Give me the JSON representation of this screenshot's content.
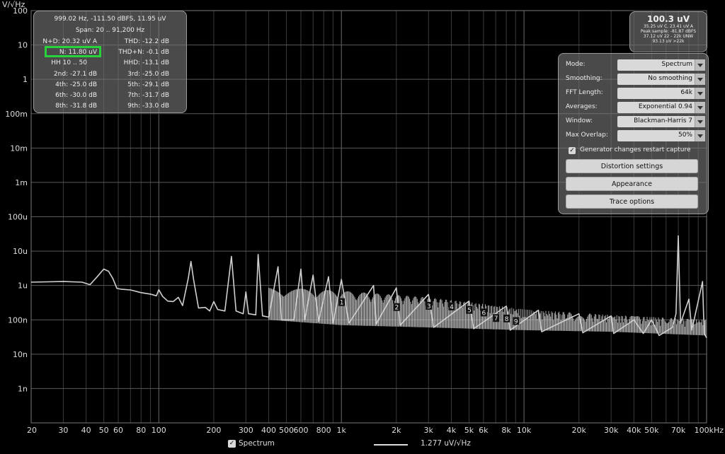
{
  "chart_data": {
    "type": "line",
    "ylabel": "V/√Hz",
    "x_scale": "log",
    "y_scale": "log",
    "xlim": [
      20,
      100000
    ],
    "ylim": [
      1e-10,
      100
    ],
    "x_ticks": [
      {
        "v": 20,
        "label": "20"
      },
      {
        "v": 30,
        "label": "30"
      },
      {
        "v": 40,
        "label": "40"
      },
      {
        "v": 50,
        "label": "50"
      },
      {
        "v": 60,
        "label": "60"
      },
      {
        "v": 80,
        "label": "80"
      },
      {
        "v": 100,
        "label": "100"
      },
      {
        "v": 200,
        "label": "200"
      },
      {
        "v": 300,
        "label": "300"
      },
      {
        "v": 400,
        "label": "400"
      },
      {
        "v": 500,
        "label": "500"
      },
      {
        "v": 600,
        "label": "600"
      },
      {
        "v": 800,
        "label": "800"
      },
      {
        "v": 1000,
        "label": "1k"
      },
      {
        "v": 2000,
        "label": "2k"
      },
      {
        "v": 3000,
        "label": "3k"
      },
      {
        "v": 4000,
        "label": "4k"
      },
      {
        "v": 5000,
        "label": "5k"
      },
      {
        "v": 6000,
        "label": "6k"
      },
      {
        "v": 8000,
        "label": "8k"
      },
      {
        "v": 10000,
        "label": "10k"
      },
      {
        "v": 20000,
        "label": "20k"
      },
      {
        "v": 30000,
        "label": "30k"
      },
      {
        "v": 40000,
        "label": "40k"
      },
      {
        "v": 50000,
        "label": "50k"
      },
      {
        "v": 70000,
        "label": "70k"
      },
      {
        "v": 100000,
        "label": "100kHz"
      }
    ],
    "y_ticks": [
      {
        "v": 100,
        "label": "100"
      },
      {
        "v": 10,
        "label": "10"
      },
      {
        "v": 1,
        "label": "1"
      },
      {
        "v": 0.1,
        "label": "100m"
      },
      {
        "v": 0.01,
        "label": "10m"
      },
      {
        "v": 0.001,
        "label": "1m"
      },
      {
        "v": 0.0001,
        "label": "100u"
      },
      {
        "v": 1e-05,
        "label": "10u"
      },
      {
        "v": 1e-06,
        "label": "1u"
      },
      {
        "v": 1e-07,
        "label": "100n"
      },
      {
        "v": 1e-08,
        "label": "10n"
      },
      {
        "v": 1e-09,
        "label": "1n"
      }
    ],
    "grid": true,
    "series": [
      {
        "name": "Spectrum",
        "color": "#d0d0d0",
        "points": [
          [
            20,
            1.25e-06
          ],
          [
            30,
            1.3e-06
          ],
          [
            38,
            1.25e-06
          ],
          [
            42,
            1.05e-06
          ],
          [
            46,
            1.8e-06
          ],
          [
            50,
            3e-06
          ],
          [
            53,
            2.6e-06
          ],
          [
            56,
            1.6e-06
          ],
          [
            59,
            8.2e-07
          ],
          [
            62,
            7.8e-07
          ],
          [
            70,
            7.4e-07
          ],
          [
            80,
            6.2e-07
          ],
          [
            90,
            5.6e-07
          ],
          [
            97,
            5e-07
          ],
          [
            100,
            7.5e-07
          ],
          [
            105,
            4.8e-07
          ],
          [
            112,
            3.5e-07
          ],
          [
            120,
            3.4e-07
          ],
          [
            128,
            4.5e-07
          ],
          [
            135,
            2.6e-07
          ],
          [
            145,
            1.6e-06
          ],
          [
            150,
            5e-06
          ],
          [
            155,
            1.5e-06
          ],
          [
            165,
            2.2e-07
          ],
          [
            180,
            2.3e-07
          ],
          [
            190,
            1.8e-07
          ],
          [
            200,
            3.4e-07
          ],
          [
            210,
            2e-07
          ],
          [
            230,
            1.8e-07
          ],
          [
            250,
            7e-06
          ],
          [
            265,
            1.8e-07
          ],
          [
            290,
            1.5e-07
          ],
          [
            300,
            6.5e-07
          ],
          [
            310,
            1.5e-07
          ],
          [
            340,
            1.4e-07
          ],
          [
            350,
            8e-06
          ],
          [
            370,
            1.3e-07
          ],
          [
            400,
            1.2e-07
          ],
          [
            450,
            3.5e-06
          ],
          [
            470,
            1e-07
          ],
          [
            550,
            1e-07
          ],
          [
            600,
            3e-06
          ],
          [
            630,
            1e-07
          ],
          [
            700,
            2e-06
          ],
          [
            750,
            9e-08
          ],
          [
            850,
            1.8e-06
          ],
          [
            900,
            8e-08
          ],
          [
            1000,
            1.5e-06
          ],
          [
            1100,
            8e-08
          ],
          [
            1500,
            1e-06
          ],
          [
            1550,
            7.5e-08
          ],
          [
            2000,
            8.5e-07
          ],
          [
            2100,
            7e-08
          ],
          [
            3000,
            5.5e-07
          ],
          [
            3200,
            6e-08
          ],
          [
            5000,
            3.5e-07
          ],
          [
            5300,
            5.5e-08
          ],
          [
            8000,
            2.5e-07
          ],
          [
            8400,
            5e-08
          ],
          [
            12000,
            1.9e-07
          ],
          [
            12500,
            4.5e-08
          ],
          [
            20000,
            1.5e-07
          ],
          [
            21000,
            4.2e-08
          ],
          [
            30000,
            1.3e-07
          ],
          [
            31000,
            4e-08
          ],
          [
            40000,
            1e-07
          ],
          [
            45000,
            4e-08
          ],
          [
            50000,
            1e-07
          ],
          [
            55000,
            3.5e-08
          ],
          [
            65000,
            6e-08
          ],
          [
            68000,
            1.5e-07
          ],
          [
            70000,
            2.8e-05
          ],
          [
            72000,
            8e-08
          ],
          [
            80000,
            4e-07
          ],
          [
            83000,
            5e-08
          ],
          [
            95000,
            1.3e-06
          ],
          [
            97000,
            4e-08
          ],
          [
            100000,
            3e-08
          ]
        ]
      }
    ],
    "floor": [
      [
        400,
        1e-07
      ],
      [
        1000,
        7e-08
      ],
      [
        3000,
        6e-08
      ],
      [
        10000,
        5e-08
      ],
      [
        30000,
        4.5e-08
      ],
      [
        100000,
        3.5e-08
      ]
    ],
    "envelope": [
      [
        400,
        9e-07
      ],
      [
        1000,
        7e-07
      ],
      [
        3000,
        4.5e-07
      ],
      [
        6000,
        2.9e-07
      ],
      [
        10000,
        2e-07
      ],
      [
        30000,
        1.4e-07
      ],
      [
        100000,
        1e-07
      ]
    ],
    "harmonic_markers": [
      {
        "label": "1",
        "f": 999.02,
        "v": 3.2e-07
      },
      {
        "label": "2",
        "f": 2000,
        "v": 2.3e-07
      },
      {
        "label": "3",
        "f": 3000,
        "v": 2.5e-07
      },
      {
        "label": "4",
        "f": 4000,
        "v": 2.4e-07
      },
      {
        "label": "5",
        "f": 5000,
        "v": 1.9e-07
      },
      {
        "label": "6",
        "f": 6000,
        "v": 1.6e-07
      },
      {
        "label": "7",
        "f": 7000,
        "v": 1.1e-07
      },
      {
        "label": "8",
        "f": 8000,
        "v": 1.07e-07
      },
      {
        "label": "9",
        "f": 9000,
        "v": 9e-08
      }
    ]
  },
  "info": {
    "line1": "999.02 Hz, -111.50 dBFS, 11.95 uV",
    "span_label": "Span:",
    "span_value": "20 .. 91,200 Hz",
    "rows": [
      {
        "l_label": "N+D:",
        "l_value": "20.32 uV A",
        "r_label": "THD:",
        "r_value": "-12.2 dB"
      },
      {
        "l_label": "N:",
        "l_value": "11.80 uV",
        "r_label": "THD+N:",
        "r_value": "-0.1 dB"
      },
      {
        "l_label": "HH 10 .. 50",
        "l_value": "",
        "r_label": "HHD:",
        "r_value": "-13.1 dB"
      },
      {
        "l_label": "2nd:",
        "l_value": "-27.1 dB",
        "r_label": "3rd:",
        "r_value": "-25.0 dB"
      },
      {
        "l_label": "4th:",
        "l_value": "-25.0 dB",
        "r_label": "5th:",
        "r_value": "-29.1 dB"
      },
      {
        "l_label": "6th:",
        "l_value": "-30.0 dB",
        "r_label": "7th:",
        "r_value": "-31.7 dB"
      },
      {
        "l_label": "8th:",
        "l_value": "-31.8 dB",
        "r_label": "9th:",
        "r_value": "-33.0 dB"
      }
    ]
  },
  "rms": {
    "main": "100.3 uV",
    "lines": [
      "35.25 uV C, 23.41 uV A",
      "Peak sample: -81.87 dBFS",
      "37.12 uV 22 - 22k UNW",
      "93.13 uV >22k"
    ]
  },
  "settings": {
    "rows": [
      {
        "label": "Mode:",
        "value": "Spectrum"
      },
      {
        "label": "Smoothing:",
        "value": "No smoothing"
      },
      {
        "label": "FFT Length:",
        "value": "64k"
      },
      {
        "label": "Averages:",
        "value": "Exponential 0.94"
      },
      {
        "label": "Window:",
        "value": "Blackman-Harris 7"
      },
      {
        "label": "Max Overlap:",
        "value": "50%"
      }
    ],
    "checkbox_label": "Generator changes restart capture",
    "checkbox_mark": "✓",
    "buttons": [
      "Distortion settings",
      "Appearance",
      "Trace options"
    ]
  },
  "legend": {
    "checkbox_mark": "✓",
    "label": "Spectrum",
    "value": "1.277 uV/√Hz"
  }
}
